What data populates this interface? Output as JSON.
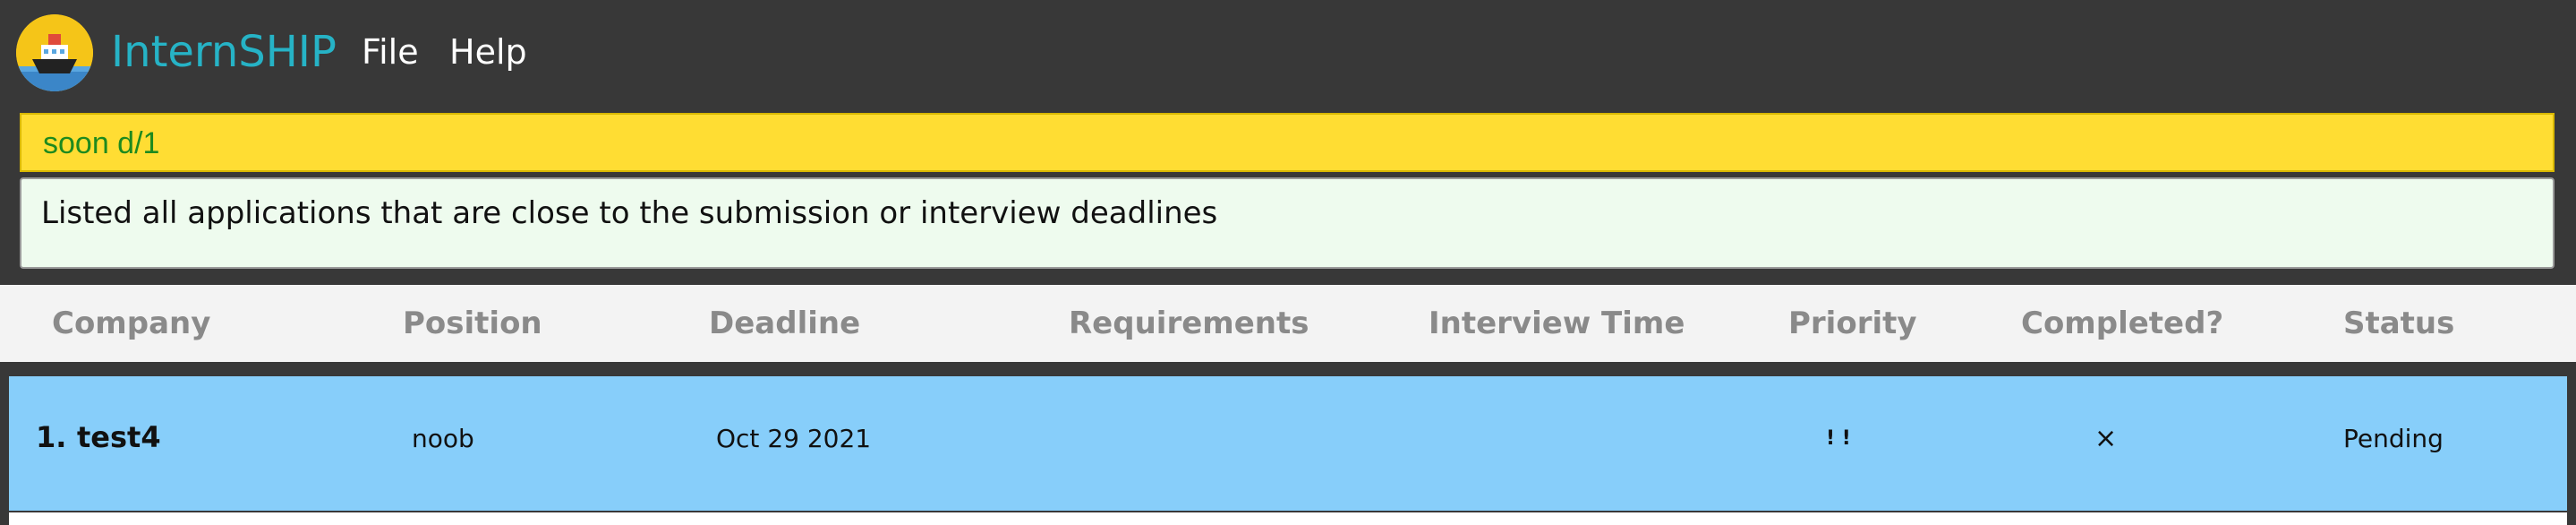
{
  "header": {
    "app_title": "InternSHIP",
    "logo_icon": "ship-logo-icon",
    "menu": [
      {
        "label": "File"
      },
      {
        "label": "Help"
      }
    ]
  },
  "command": {
    "value": "soon d/1"
  },
  "result": {
    "message": "Listed all applications that are close to the submission or interview deadlines"
  },
  "table": {
    "columns": [
      "Company",
      "Position",
      "Deadline",
      "Requirements",
      "Interview Time",
      "Priority",
      "Completed?",
      "Status"
    ],
    "rows": [
      {
        "index": "1.",
        "company": "test4",
        "position": "noob",
        "deadline": "Oct 29 2021",
        "requirements": "",
        "interview_time": "",
        "priority": "! !",
        "completed": "×",
        "status": "Pending"
      }
    ]
  },
  "colors": {
    "background": "#383838",
    "title_accent": "#26b3c6",
    "command_bg": "#ffdd33",
    "command_text": "#1e8a1e",
    "result_bg": "#eefbee",
    "row_highlight": "#87cefa"
  }
}
